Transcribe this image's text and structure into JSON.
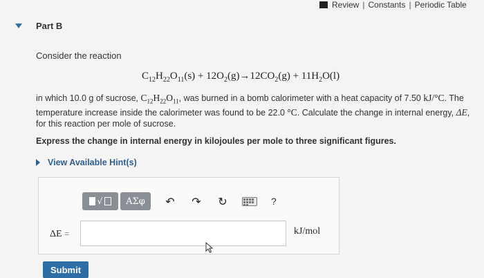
{
  "header": {
    "review": "Review",
    "constants": "Constants",
    "periodic_table": "Periodic Table"
  },
  "part": {
    "label": "Part B"
  },
  "problem": {
    "intro": "Consider the reaction",
    "equation": {
      "reactant1": "C12H22O11(s)",
      "plus1": "+",
      "reactant2": "12O2(g)",
      "arrow": "→",
      "product1": "12CO2(g)",
      "plus2": "+",
      "product2": "11H2O(l)"
    },
    "para_1": "in which 10.0 g of sucrose, ",
    "para_2": ", was burned in a bomb calorimeter with a heat capacity of 7.50 ",
    "para_unit": "kJ/°C",
    "para_3": ". The temperature increase inside the calorimeter was found to be 22.0 ",
    "para_deg": "°C",
    "para_4": ". Calculate the change in internal energy, ",
    "para_var": "ΔE",
    "para_5": ", for this reaction per mole of sucrose.",
    "instruction": "Express the change in internal energy in kilojoules per mole to three significant figures."
  },
  "hint": {
    "label": "View Available Hint(s)"
  },
  "toolbar": {
    "greek_label": "ΑΣφ",
    "undo_glyph": "↶",
    "redo_glyph": "↷",
    "reset_glyph": "↻",
    "help_label": "?"
  },
  "answer": {
    "variable_label": "ΔE",
    "equals": "=",
    "value": "",
    "unit": "kJ/mol"
  },
  "submit": {
    "label": "Submit"
  },
  "colors": {
    "link_blue": "#2f5f8f",
    "button_blue": "#2e6ea6",
    "toolbar_gray": "#8a8f96"
  }
}
